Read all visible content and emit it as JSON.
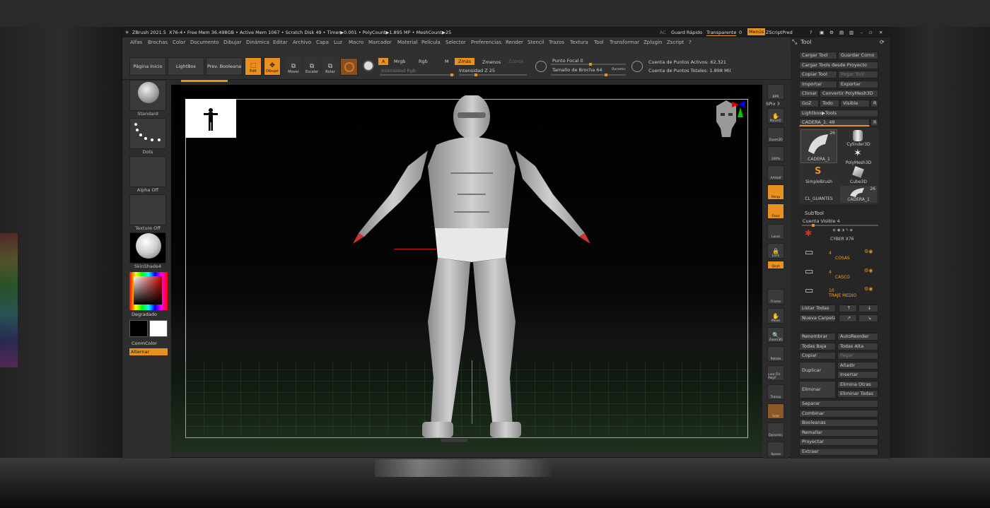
{
  "titlebar": {
    "app": "ZBrush 2021.5",
    "doc": "X76-4",
    "stats": "• Free Mem 36.498GB • Active Mem 1067 • Scratch Disk 49 • Timer▶0.001 • PolyCount▶1.895 MP • MeshCount▶25",
    "ai": "AC",
    "quicksave": "Guard Rápido",
    "transparent": "Transparente",
    "transparent_val": "0",
    "menus": "Menús",
    "zscript": "ZScriptPred"
  },
  "menubar": [
    "Alfas",
    "Brochas",
    "Color",
    "Documento",
    "Dibujar",
    "Dinámica",
    "Editar",
    "Archivo",
    "Capa",
    "Luz",
    "Macro",
    "Marcador",
    "Material",
    "Película",
    "Selector",
    "Preferencias",
    "Render",
    "Stencil",
    "Trazos",
    "Textura",
    "Tool",
    "Transformar",
    "Zplugin",
    "Zscript",
    "?"
  ],
  "toolbar": {
    "home": "Página Inicio",
    "lightbox": "LightBox",
    "boolean": "Prev. Booleana",
    "edit": "Edit",
    "draw": "Dibujar",
    "move": "Mover",
    "scale": "Escalar",
    "rotate": "Rotar",
    "a_label": "A",
    "mrgb": "Mrgb",
    "rgb": "Rgb",
    "m": "M",
    "zadd": "Zmás",
    "zsub": "Zmenos",
    "zcut": "Zcorte",
    "rgb_intensity": "Intensidad Rgb",
    "z_intensity": "Intensidad Z 25",
    "focal": "Punto Focal 0",
    "draw_size": "Tamaño de Brocha 64",
    "dynamic": "Dynamic",
    "active_points": "Cuenta de Puntos Activos: 62,321",
    "total_points": "Cuenta de Puntos Totales: 1.898 Mil"
  },
  "leftpanel": {
    "brush": "Standard",
    "stroke": "Dots",
    "alpha": "Alpha Off",
    "texture": "Texture Off",
    "material": "SkinShade4",
    "gradient": "Degradado",
    "switchcolor": "ConmColor",
    "alternate": "Alternar"
  },
  "rightstrip": [
    "BPR",
    "SPix 3",
    "Move©",
    "Zoom2D",
    "100%",
    "AAHalf",
    "Persp",
    "Floor",
    "Local",
    "Lock",
    "Qxyz",
    "Frame",
    "Move",
    "Zoom3D",
    "Rotate",
    "Line Fill PolyF",
    "Transp",
    "Solo",
    "Dynamic",
    "Xpose"
  ],
  "toolpanel": {
    "title": "Tool",
    "load": "Cargar Tool",
    "saveas": "Guardar Como",
    "loadproject": "Cargar Tools desde Proyecto",
    "copytool": "Copiar Tool",
    "pastetool": "Pegar Tool",
    "import": "Importar",
    "export": "Exportar",
    "clone": "Clonar",
    "makepoly": "Convertir PolyMesh3D",
    "goz": "GoZ",
    "all": "Todo",
    "visible": "Visible",
    "r": "R",
    "lightboxtools": "Lightbox▶Tools",
    "current": "CADERA_1. 48",
    "tools": [
      {
        "name": "CADERA_1",
        "count": "26"
      },
      {
        "name": "Cylinder3D",
        "count": ""
      },
      {
        "name": "PolyMesh3D",
        "count": ""
      },
      {
        "name": "SimpleBrush",
        "count": ""
      },
      {
        "name": "Cube3D",
        "count": ""
      },
      {
        "name": "CL_GUANTES",
        "count": ""
      },
      {
        "name": "CADERA_1",
        "count": "26"
      }
    ],
    "subtool": "SubTool",
    "visiblecount": "Cuenta Visible 4",
    "subtools": [
      {
        "name": "CYBER X76",
        "num": ""
      },
      {
        "name": "COSAS",
        "num": "4"
      },
      {
        "name": "CASCO",
        "num": "4"
      },
      {
        "name": "TRAJE MEDIO",
        "num": "10"
      }
    ],
    "listall": "Listar Todas",
    "newfolder": "Nueva Carpeta",
    "rename": "Renombrar",
    "autoreorder": "AutoReorder",
    "alllow": "Todas Baja",
    "allhigh": "Todas Alta",
    "copy": "Copiar",
    "paste": "Pegar",
    "duplicate": "Duplicar",
    "append": "Añadir",
    "insert": "Insertar",
    "delete": "Eliminar",
    "delother": "Elimina Otras",
    "delall": "Eliminar Todas",
    "split": "Separar",
    "merge": "Combinar",
    "boolean": "Booleanas",
    "remesh": "Remallar",
    "project": "Proyectar",
    "extract": "Extraer"
  },
  "colors": {
    "accent": "#e89020",
    "panel": "#2b2b2b",
    "orange_text": "#f0a030"
  }
}
